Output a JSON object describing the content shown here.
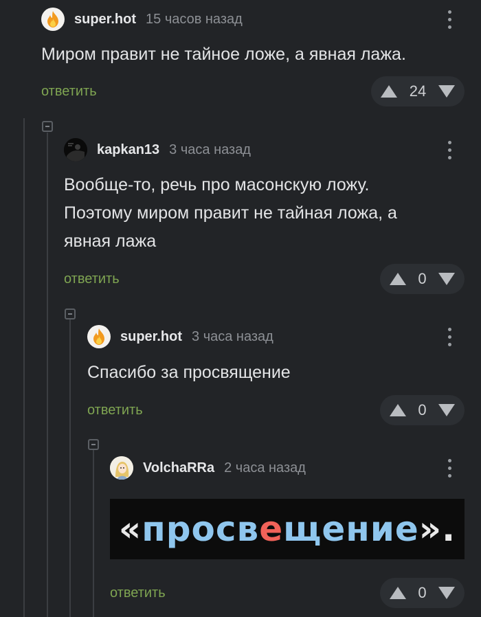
{
  "comments": [
    {
      "username": "super.hot",
      "time": "15 часов назад",
      "text": "Миром правит не тайное ложе, а явная лажа.",
      "reply_label": "ответить",
      "votes": "24",
      "avatar_icon": "fire-icon"
    },
    {
      "username": "kapkan13",
      "time": "3 часа назад",
      "text_lines": [
        "Вообще-то, речь про масонскую ложу.",
        "Поэтому миром правит не тайная ложа, а",
        "явная лажа"
      ],
      "reply_label": "ответить",
      "votes": "0",
      "avatar_icon": "dark-avatar-icon"
    },
    {
      "username": "super.hot",
      "time": "3 часа назад",
      "text": "Спасибо за просвящение",
      "reply_label": "ответить",
      "votes": "0",
      "avatar_icon": "fire-icon"
    },
    {
      "username": "VolchaRRa",
      "time": "2 часа назад",
      "image_text": {
        "open_quote": "«",
        "part1": "просв",
        "highlight": "е",
        "part2": "щение",
        "close": "»."
      },
      "reply_label": "ответить",
      "votes": "0",
      "avatar_icon": "anime-avatar-icon"
    }
  ],
  "colors": {
    "background": "#222427",
    "reply": "#7fa552",
    "vote_pill": "#2c2f33",
    "highlight_letter": "#f06259",
    "image_text": "#8fc6ee"
  }
}
